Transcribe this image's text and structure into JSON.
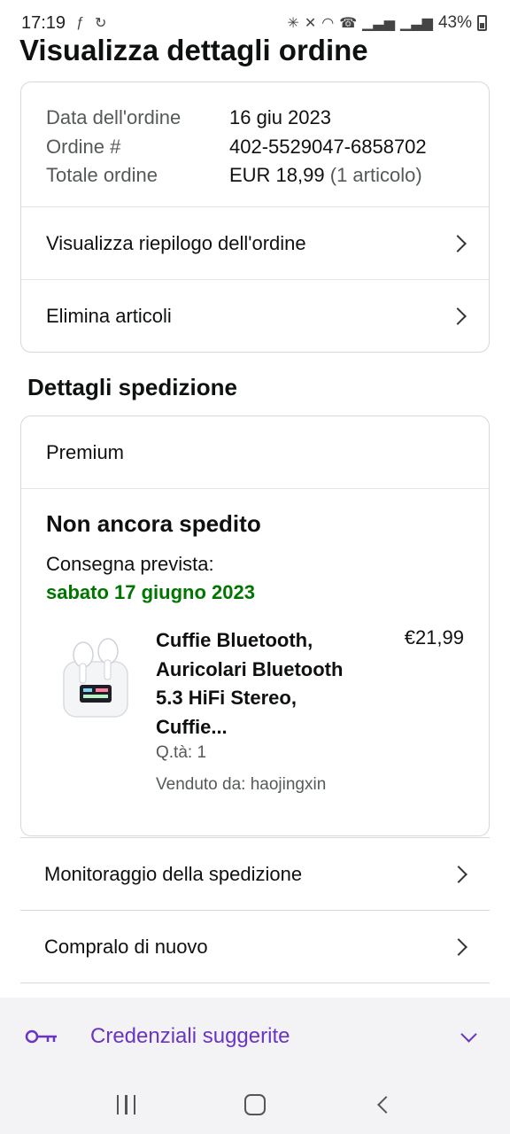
{
  "status_bar": {
    "time": "17:19",
    "battery": "43%",
    "left_icons": [
      "f-app-icon",
      "sync-icon"
    ],
    "right_icons": [
      "bluetooth-icon",
      "mute-icon",
      "wifi-icon",
      "wifi-calling-icon",
      "signal-icon",
      "signal-icon-2",
      "battery-icon"
    ]
  },
  "page": {
    "title": "Visualizza dettagli ordine"
  },
  "order": {
    "rows": [
      {
        "label": "Data dell'ordine",
        "value": "16 giu 2023"
      },
      {
        "label": "Ordine #",
        "value": "402-5529047-6858702"
      },
      {
        "label": "Totale ordine",
        "value": "EUR 18,99",
        "extra": "(1 articolo)"
      }
    ],
    "summary_link": "Visualizza riepilogo dell'ordine",
    "delete_link": "Elimina articoli"
  },
  "shipping": {
    "section_title": "Dettagli spedizione",
    "method": "Premium",
    "status": "Non ancora spedito",
    "delivery_label": "Consegna prevista:",
    "delivery_date": "sabato 17 giugno 2023",
    "item": {
      "title": "Cuffie Bluetooth, Auricolari Bluetooth 5.3 HiFi Stereo, Cuffie...",
      "price": "€21,99",
      "quantity": "Q.tà: 1",
      "seller": "Venduto da: haojingxin"
    }
  },
  "actions": {
    "track": "Monitoraggio della spedizione",
    "buy_again": "Compralo di nuovo"
  },
  "credentials_bar": {
    "label": "Credenziali suggerite",
    "accent_color": "#6a35c2"
  },
  "colors": {
    "delivery_green": "#007600",
    "border": "#d5d9d9"
  }
}
